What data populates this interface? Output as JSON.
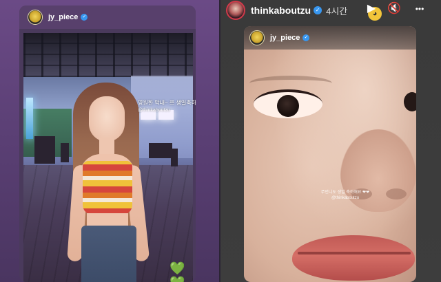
{
  "left_story": {
    "username": "jy_piece",
    "caption": "영원한 막내~ 쯔 생일축하해!!!!",
    "mention": "@thinkaboutzu",
    "hearts": "💚💚"
  },
  "right_story": {
    "top_bar": {
      "username": "thinkaboutzu",
      "time": "4시간",
      "play_icon": "▶",
      "mute_icon": "🔇",
      "more_icon": "•••"
    },
    "inner_username": "jy_piece",
    "caption": "쭈언니도 생일 축하해요 ❤❤",
    "mention": "@thinkaboutzu"
  }
}
